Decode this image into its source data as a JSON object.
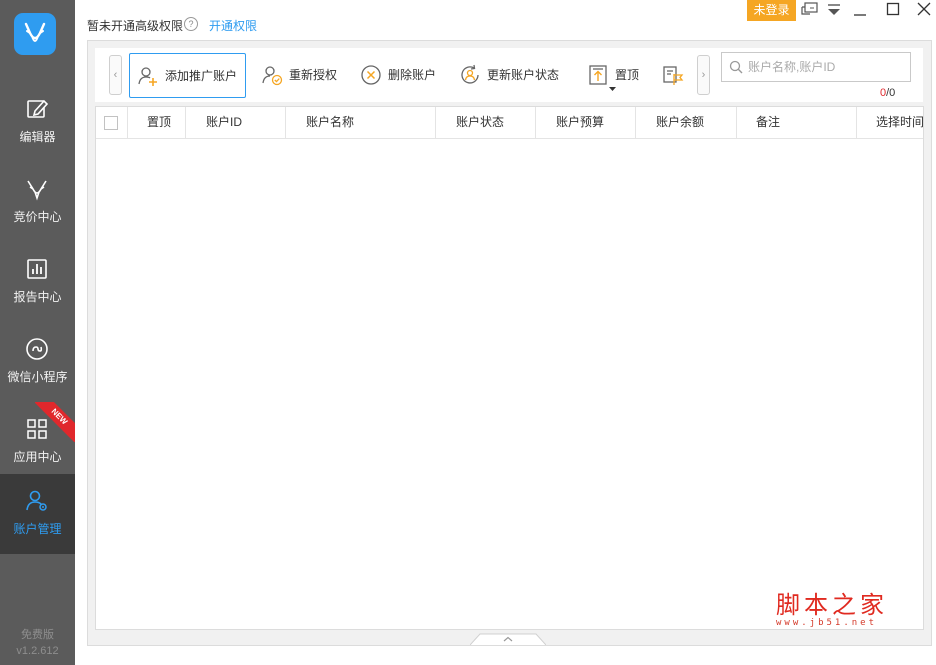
{
  "topbar": {
    "notice": "暂未开通高级权限",
    "help": "?",
    "open_link": "开通权限",
    "login_badge": "未登录"
  },
  "sidebar": {
    "items": [
      {
        "label": "编辑器",
        "icon": "edit-icon"
      },
      {
        "label": "竞价中心",
        "icon": "deer-antler-icon"
      },
      {
        "label": "报告中心",
        "icon": "bar-chart-icon"
      },
      {
        "label": "微信小程序",
        "icon": "mini-program-icon"
      },
      {
        "label": "应用中心",
        "icon": "grid-apps-icon",
        "badge": "NEW"
      },
      {
        "label": "账户管理",
        "icon": "users-gear-icon",
        "active": true
      }
    ],
    "edition": "免费版",
    "version": "v1.2.612"
  },
  "toolbar": {
    "add": "添加推广账户",
    "reauth": "重新授权",
    "delete": "删除账户",
    "update_status": "更新账户状态",
    "pin_top": "置顶"
  },
  "search": {
    "placeholder": "账户名称,账户ID",
    "count_current": "0",
    "count_total": "/0"
  },
  "table": {
    "columns": [
      "置顶",
      "账户ID",
      "账户名称",
      "账户状态",
      "账户预算",
      "账户余额",
      "备注",
      "选择时间"
    ]
  },
  "watermark": {
    "title": "脚本之家",
    "url": "www.jb51.net"
  },
  "colors": {
    "accent": "#2f9cf0",
    "sidebar_bg": "#5b5b5b",
    "login_badge": "#f5a623",
    "new_badge": "#e0282c",
    "watermark": "#e02a20"
  }
}
